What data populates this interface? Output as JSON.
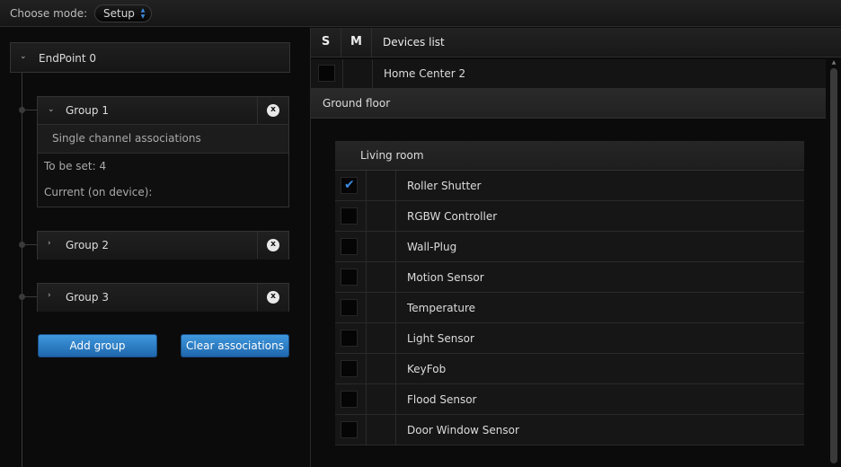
{
  "topbar": {
    "mode_label": "Choose mode:",
    "mode_value": "Setup"
  },
  "left": {
    "endpoint_label": "EndPoint 0",
    "groups": [
      {
        "label": "Group 1",
        "subheading": "Single channel associations",
        "to_be_set": "To be set: 4",
        "current": "Current (on device):"
      },
      {
        "label": "Group 2"
      },
      {
        "label": "Group 3"
      }
    ],
    "close_glyph": "x",
    "add_group_label": "Add group",
    "clear_label": "Clear associations"
  },
  "right": {
    "header_s": "S",
    "header_m": "M",
    "header_devices": "Devices list",
    "home_center": "Home Center 2",
    "floor": "Ground floor",
    "room": "Living room",
    "devices": [
      {
        "name": "Roller Shutter",
        "checked": true
      },
      {
        "name": "RGBW Controller",
        "checked": false
      },
      {
        "name": "Wall-Plug",
        "checked": false
      },
      {
        "name": "Motion Sensor",
        "checked": false
      },
      {
        "name": "Temperature",
        "checked": false
      },
      {
        "name": "Light Sensor",
        "checked": false
      },
      {
        "name": "KeyFob",
        "checked": false
      },
      {
        "name": "Flood Sensor",
        "checked": false
      },
      {
        "name": "Door Window Sensor",
        "checked": false
      }
    ]
  },
  "colors": {
    "accent": "#3b8be0",
    "button_top": "#3f98dd",
    "button_bottom": "#1e66ad"
  }
}
